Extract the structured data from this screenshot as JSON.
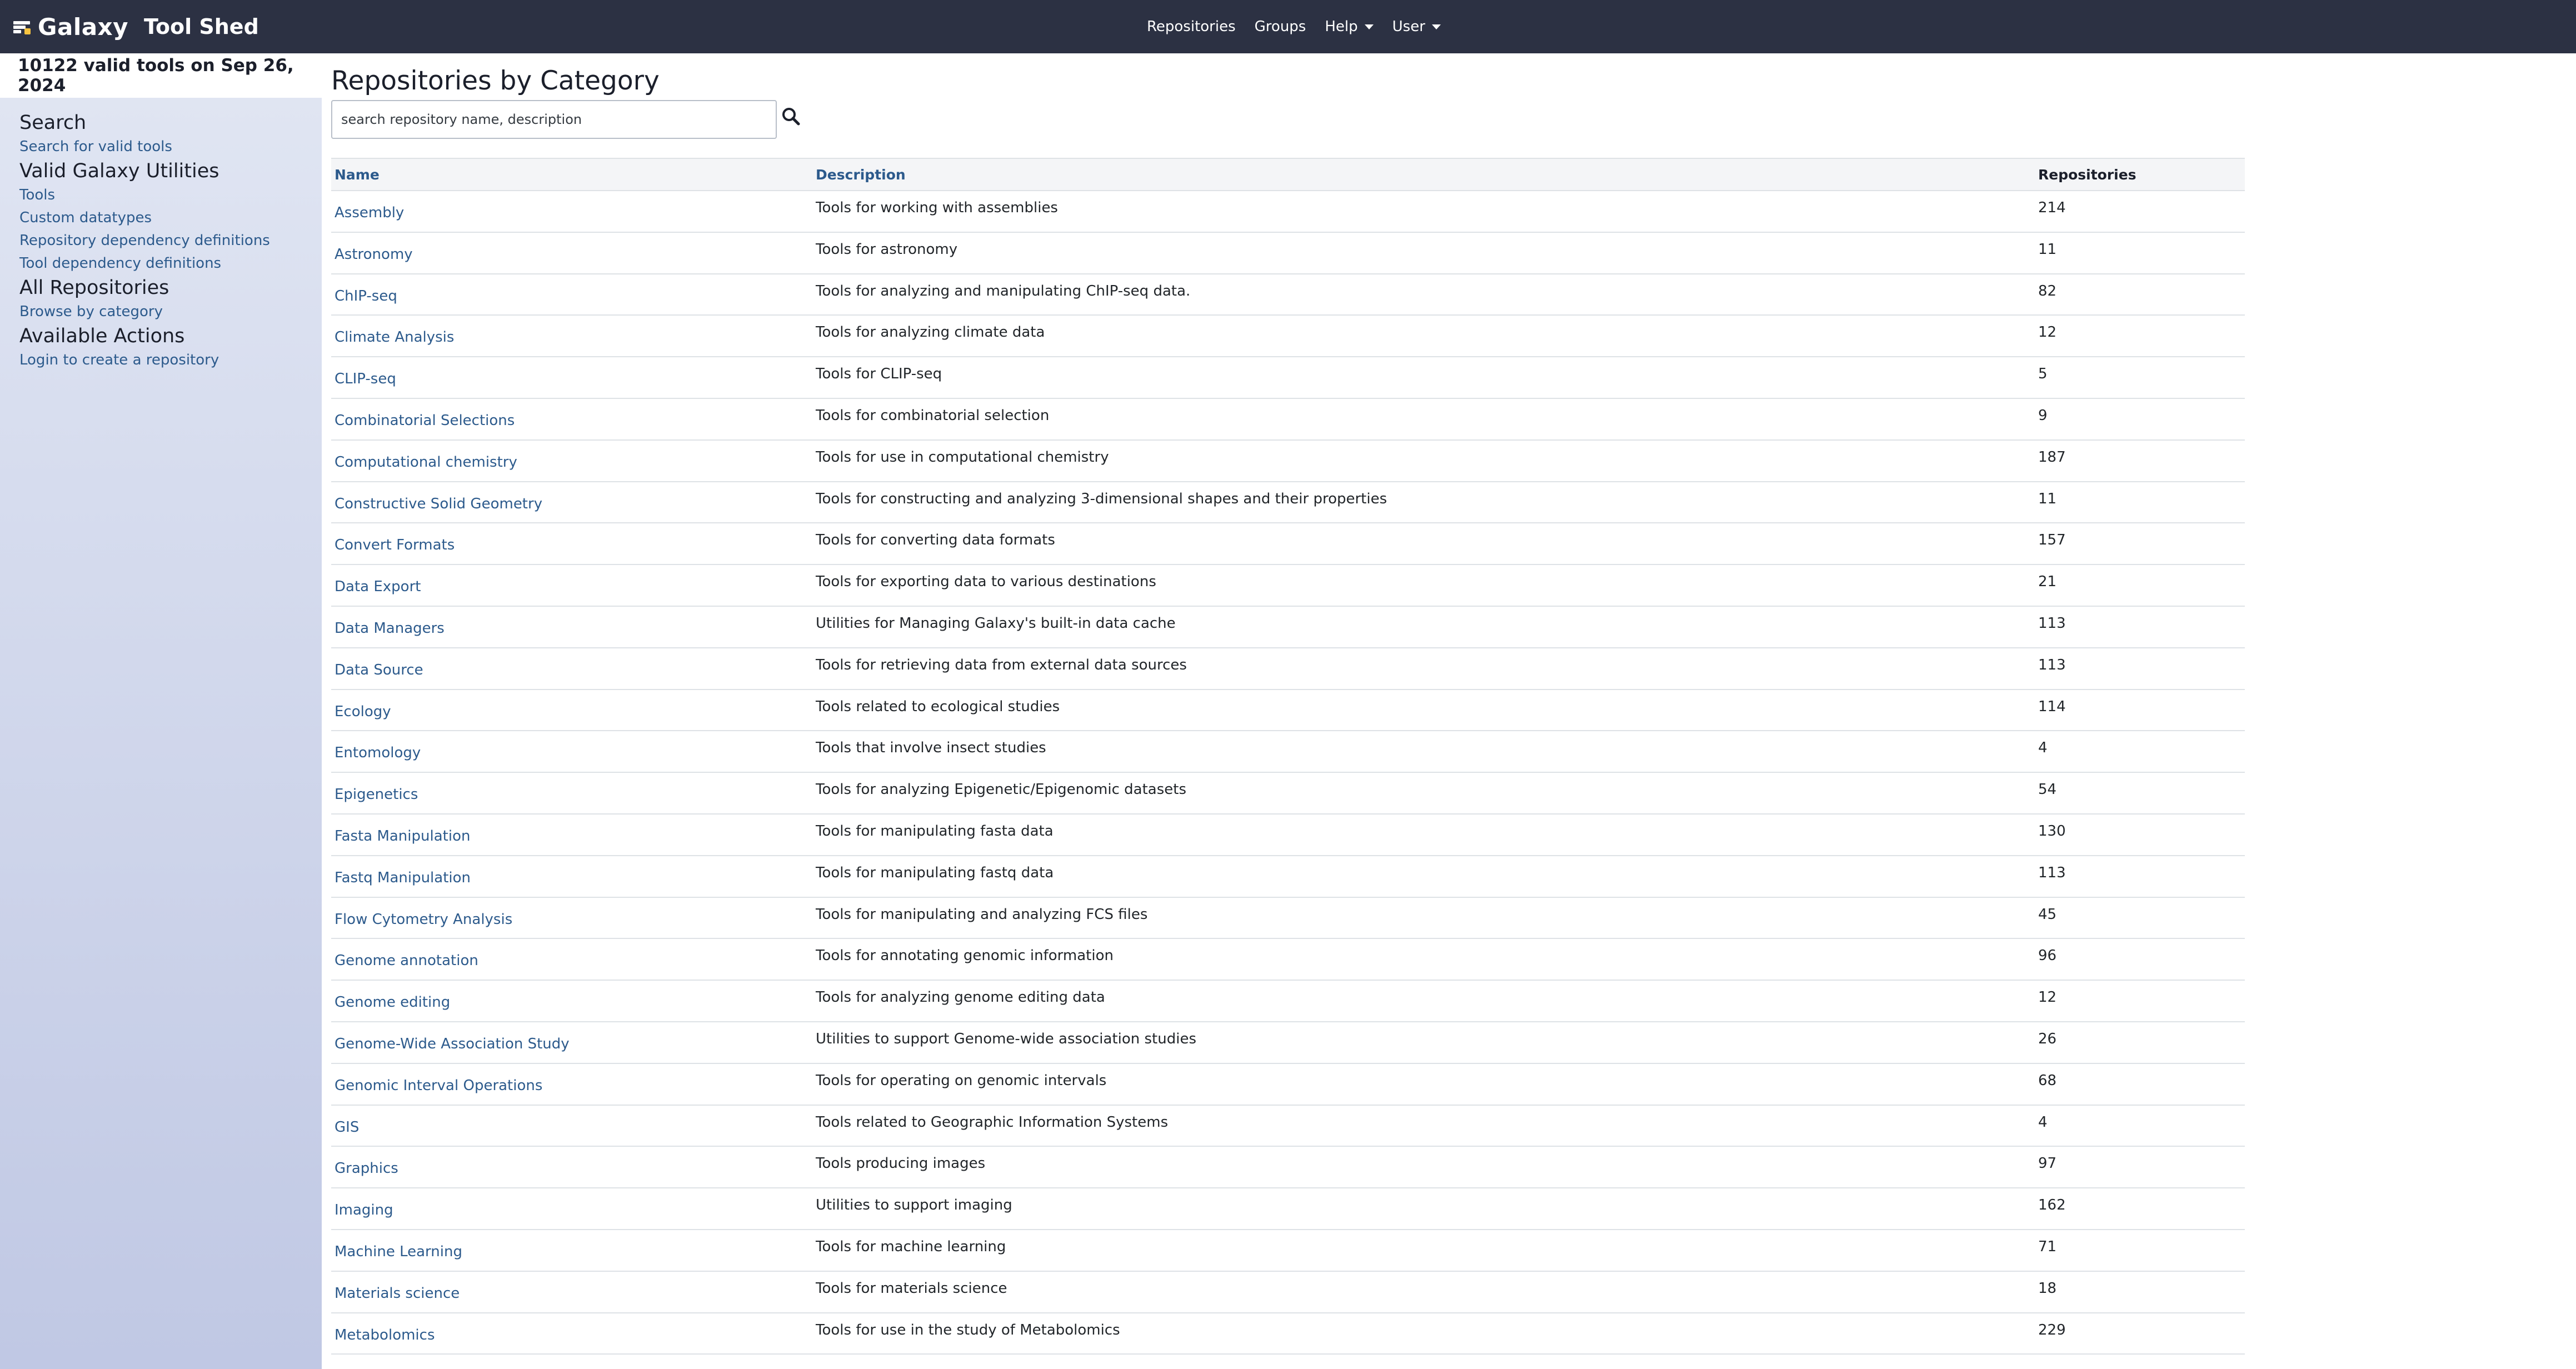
{
  "header": {
    "brand": "Galaxy",
    "title": "Tool Shed",
    "nav": [
      {
        "label": "Repositories",
        "dropdown": false
      },
      {
        "label": "Groups",
        "dropdown": false
      },
      {
        "label": "Help",
        "dropdown": true
      },
      {
        "label": "User",
        "dropdown": true
      }
    ]
  },
  "sidebar": {
    "tool_count_text": "10122 valid tools on Sep 26, 2024",
    "sections": [
      {
        "title": "Search",
        "links": [
          "Search for valid tools"
        ]
      },
      {
        "title": "Valid Galaxy Utilities",
        "links": [
          "Tools",
          "Custom datatypes",
          "Repository dependency definitions",
          "Tool dependency definitions"
        ]
      },
      {
        "title": "All Repositories",
        "links": [
          "Browse by category"
        ]
      },
      {
        "title": "Available Actions",
        "links": [
          "Login to create a repository"
        ]
      }
    ]
  },
  "main": {
    "title": "Repositories by Category",
    "search_placeholder": "search repository name, description",
    "columns": {
      "name": "Name",
      "description": "Description",
      "repositories": "Repositories"
    },
    "rows": [
      {
        "name": "Assembly",
        "description": "Tools for working with assemblies",
        "count": "214"
      },
      {
        "name": "Astronomy",
        "description": "Tools for astronomy",
        "count": "11"
      },
      {
        "name": "ChIP-seq",
        "description": "Tools for analyzing and manipulating ChIP-seq data.",
        "count": "82"
      },
      {
        "name": "Climate Analysis",
        "description": "Tools for analyzing climate data",
        "count": "12"
      },
      {
        "name": "CLIP-seq",
        "description": "Tools for CLIP-seq",
        "count": "5"
      },
      {
        "name": "Combinatorial Selections",
        "description": "Tools for combinatorial selection",
        "count": "9"
      },
      {
        "name": "Computational chemistry",
        "description": "Tools for use in computational chemistry",
        "count": "187"
      },
      {
        "name": "Constructive Solid Geometry",
        "description": "Tools for constructing and analyzing 3-dimensional shapes and their properties",
        "count": "11"
      },
      {
        "name": "Convert Formats",
        "description": "Tools for converting data formats",
        "count": "157"
      },
      {
        "name": "Data Export",
        "description": "Tools for exporting data to various destinations",
        "count": "21"
      },
      {
        "name": "Data Managers",
        "description": "Utilities for Managing Galaxy's built-in data cache",
        "count": "113"
      },
      {
        "name": "Data Source",
        "description": "Tools for retrieving data from external data sources",
        "count": "113"
      },
      {
        "name": "Ecology",
        "description": "Tools related to ecological studies",
        "count": "114"
      },
      {
        "name": "Entomology",
        "description": "Tools that involve insect studies",
        "count": "4"
      },
      {
        "name": "Epigenetics",
        "description": "Tools for analyzing Epigenetic/Epigenomic datasets",
        "count": "54"
      },
      {
        "name": "Fasta Manipulation",
        "description": "Tools for manipulating fasta data",
        "count": "130"
      },
      {
        "name": "Fastq Manipulation",
        "description": "Tools for manipulating fastq data",
        "count": "113"
      },
      {
        "name": "Flow Cytometry Analysis",
        "description": "Tools for manipulating and analyzing FCS files",
        "count": "45"
      },
      {
        "name": "Genome annotation",
        "description": "Tools for annotating genomic information",
        "count": "96"
      },
      {
        "name": "Genome editing",
        "description": "Tools for analyzing genome editing data",
        "count": "12"
      },
      {
        "name": "Genome-Wide Association Study",
        "description": "Utilities to support Genome-wide association studies",
        "count": "26"
      },
      {
        "name": "Genomic Interval Operations",
        "description": "Tools for operating on genomic intervals",
        "count": "68"
      },
      {
        "name": "GIS",
        "description": "Tools related to Geographic Information Systems",
        "count": "4"
      },
      {
        "name": "Graphics",
        "description": "Tools producing images",
        "count": "97"
      },
      {
        "name": "Imaging",
        "description": "Utilities to support imaging",
        "count": "162"
      },
      {
        "name": "Machine Learning",
        "description": "Tools for machine learning",
        "count": "71"
      },
      {
        "name": "Materials science",
        "description": "Tools for materials science",
        "count": "18"
      },
      {
        "name": "Metabolomics",
        "description": "Tools for use in the study of Metabolomics",
        "count": "229"
      }
    ]
  }
}
